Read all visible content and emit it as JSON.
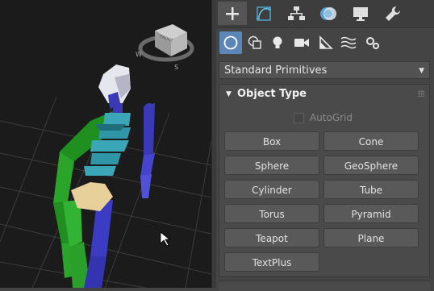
{
  "window": {
    "title": "Create panel"
  },
  "tabs": [
    {
      "name": "Create",
      "icon": "plus-icon"
    },
    {
      "name": "Modify",
      "icon": "modify-curve-icon"
    },
    {
      "name": "Hierarchy",
      "icon": "hierarchy-icon"
    },
    {
      "name": "Motion",
      "icon": "motion-icon"
    },
    {
      "name": "Display",
      "icon": "display-monitor-icon"
    },
    {
      "name": "Utilities",
      "icon": "wrench-icon"
    }
  ],
  "subcategories": [
    {
      "name": "Geometry",
      "icon": "sphere-icon"
    },
    {
      "name": "Shapes",
      "icon": "shapes-icon"
    },
    {
      "name": "Lights",
      "icon": "light-bulb-icon"
    },
    {
      "name": "Cameras",
      "icon": "camera-icon"
    },
    {
      "name": "Helpers",
      "icon": "helper-tape-icon"
    },
    {
      "name": "Space Warps",
      "icon": "wave-icon"
    },
    {
      "name": "Systems",
      "icon": "gears-icon"
    }
  ],
  "category_dropdown": {
    "value": "Standard Primitives"
  },
  "object_type": {
    "title": "Object Type",
    "autogrid_label": "AutoGrid",
    "buttons": [
      "Box",
      "Cone",
      "Sphere",
      "GeoSphere",
      "Cylinder",
      "Tube",
      "Torus",
      "Pyramid",
      "Teapot",
      "Plane",
      "TextPlus"
    ]
  },
  "viewcube": {
    "face": "FRONT",
    "compass": [
      "W",
      "S"
    ]
  },
  "colors": {
    "accent": "#5a86b8",
    "viewport_bg": "#1b1b1b",
    "panel_bg": "#444444"
  }
}
